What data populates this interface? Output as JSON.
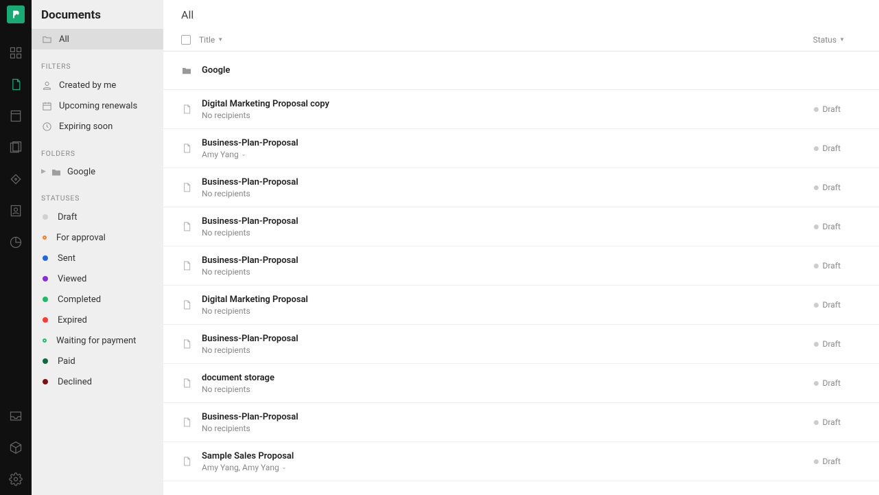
{
  "sidebar": {
    "title": "Documents",
    "all_label": "All",
    "filters_label": "FILTERS",
    "filters": [
      {
        "label": "Created by me",
        "icon": "person"
      },
      {
        "label": "Upcoming renewals",
        "icon": "calendar"
      },
      {
        "label": "Expiring soon",
        "icon": "clock"
      }
    ],
    "folders_label": "FOLDERS",
    "folders": [
      {
        "label": "Google"
      }
    ],
    "statuses_label": "STATUSES",
    "statuses": [
      {
        "label": "Draft",
        "class": "dot-draft"
      },
      {
        "label": "For approval",
        "class": "dot-approval"
      },
      {
        "label": "Sent",
        "class": "dot-sent"
      },
      {
        "label": "Viewed",
        "class": "dot-viewed"
      },
      {
        "label": "Completed",
        "class": "dot-completed"
      },
      {
        "label": "Expired",
        "class": "dot-expired"
      },
      {
        "label": "Waiting for payment",
        "class": "dot-waiting"
      },
      {
        "label": "Paid",
        "class": "dot-paid"
      },
      {
        "label": "Declined",
        "class": "dot-declined"
      }
    ]
  },
  "main": {
    "header": "All",
    "columns": {
      "title": "Title",
      "status": "Status"
    },
    "rows": [
      {
        "type": "folder",
        "title": "Google"
      },
      {
        "type": "doc",
        "title": "Digital Marketing Proposal copy",
        "sub": "No recipients",
        "status": "Draft"
      },
      {
        "type": "doc",
        "title": "Business-Plan-Proposal",
        "sub": "Amy Yang",
        "sub_has_caret": true,
        "status": "Draft"
      },
      {
        "type": "doc",
        "title": "Business-Plan-Proposal",
        "sub": "No recipients",
        "status": "Draft"
      },
      {
        "type": "doc",
        "title": "Business-Plan-Proposal",
        "sub": "No recipients",
        "status": "Draft"
      },
      {
        "type": "doc",
        "title": "Business-Plan-Proposal",
        "sub": "No recipients",
        "status": "Draft"
      },
      {
        "type": "doc",
        "title": "Digital Marketing Proposal",
        "sub": "No recipients",
        "status": "Draft"
      },
      {
        "type": "doc",
        "title": "Business-Plan-Proposal",
        "sub": "No recipients",
        "status": "Draft"
      },
      {
        "type": "doc",
        "title": "document storage",
        "sub": "No recipients",
        "status": "Draft"
      },
      {
        "type": "doc",
        "title": "Business-Plan-Proposal",
        "sub": "No recipients",
        "status": "Draft"
      },
      {
        "type": "doc",
        "title": "Sample Sales Proposal",
        "sub": "Amy Yang, Amy Yang",
        "sub_has_caret": true,
        "status": "Draft"
      }
    ]
  }
}
